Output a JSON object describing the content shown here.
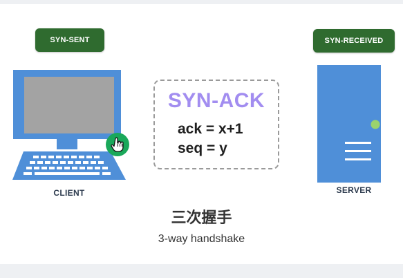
{
  "client": {
    "state": "SYN-SENT",
    "label": "CLIENT"
  },
  "server": {
    "state": "SYN-RECEIVED",
    "label": "SERVER"
  },
  "packet": {
    "flag": "SYN-ACK",
    "ack": "ack = x+1",
    "seq": "seq = y"
  },
  "caption": {
    "cn": "三次握手",
    "en": "3-way handshake"
  },
  "colors": {
    "badge": "#2f6b2f",
    "device_blue": "#4f8fd8",
    "screen_gray": "#a3a3a3",
    "flag_purple": "#a28df0",
    "cursor_green": "#1aa85a",
    "status_led": "#9bd36c"
  },
  "icons": {
    "client": "laptop-icon",
    "server": "server-tower-icon",
    "pointer": "hand-cursor-icon"
  }
}
